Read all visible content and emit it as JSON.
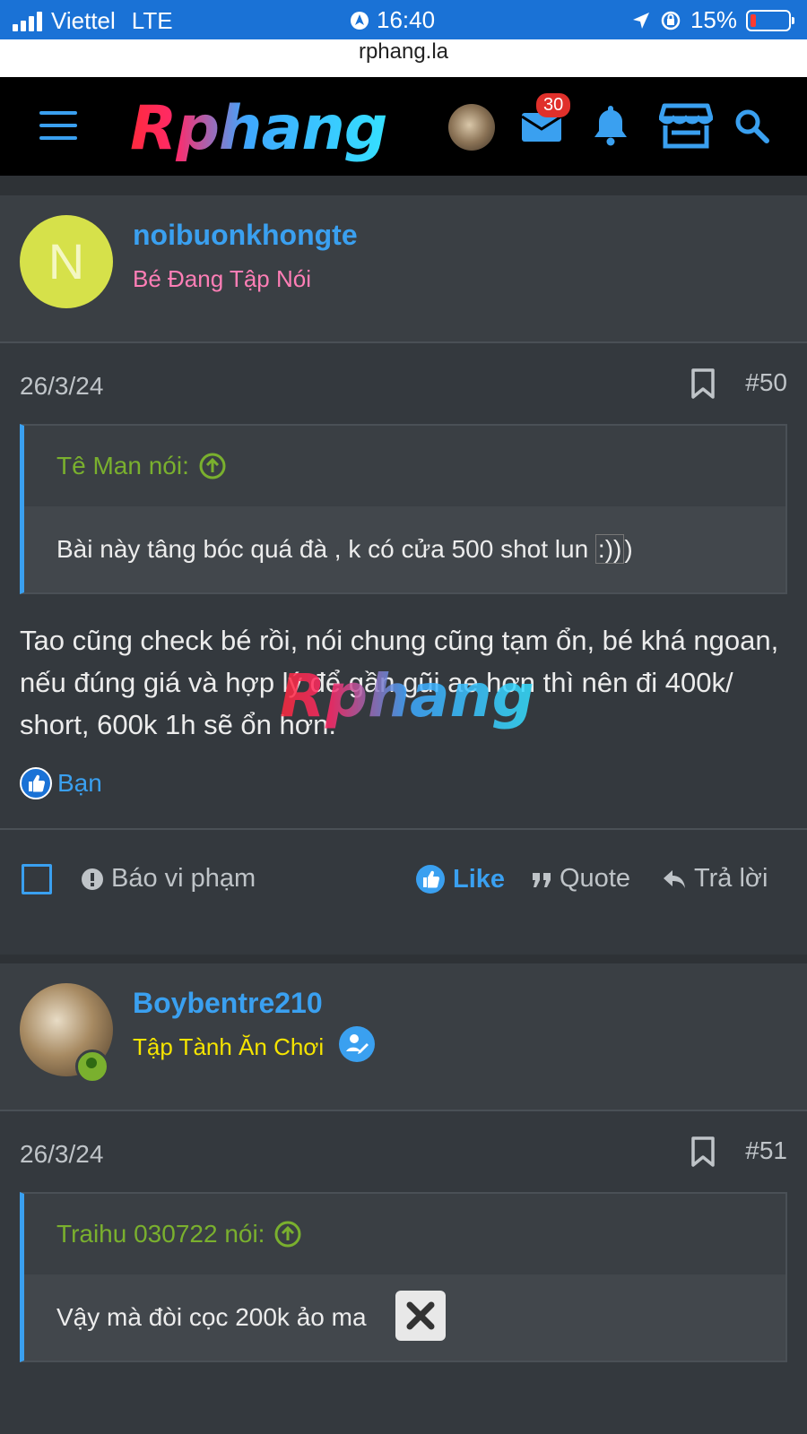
{
  "status_bar": {
    "carrier": "Viettel",
    "network": "LTE",
    "time": "16:40",
    "battery": "15%"
  },
  "browser": {
    "url": "rphang.la"
  },
  "header": {
    "logo_text": "Rphang",
    "mail_badge": "30"
  },
  "posts": [
    {
      "author": "noibuonkhongte",
      "avatar_letter": "N",
      "user_title": "Bé Đang Tập Nói",
      "user_title_color": "#ff7eb6",
      "date": "26/3/24",
      "number": "#50",
      "quote_author": "Tê Man nói:",
      "quote_text": "Bài này tâng bóc quá đà , k có cửa 500 shot lun",
      "quote_smiley": ":))",
      "quote_tail": ")",
      "text": "Tao cũng check bé rồi, nói chung cũng tạm ổn, bé khá ngoan, nếu đúng giá và hợp lý để gần gũi ae hơn thì nên đi 400k/ short, 600k 1h sẽ ổn hơn.",
      "reaction_user": "Bạn"
    },
    {
      "author": "Boybentre210",
      "user_title": "Tập Tành Ăn Chơi",
      "user_title_color": "#f5e400",
      "date": "26/3/24",
      "number": "#51",
      "quote_author": "Traihu 030722 nói:",
      "quote_text": "Vậy mà đòi cọc 200k ảo ma"
    }
  ],
  "actions": {
    "report": "Báo vi phạm",
    "like": "Like",
    "quote": "Quote",
    "reply": "Trả lời"
  },
  "watermark": "Rphang",
  "colors": {
    "accent": "#3aa0f0",
    "quote_author": "#7ab02e",
    "background": "#2e3236"
  }
}
